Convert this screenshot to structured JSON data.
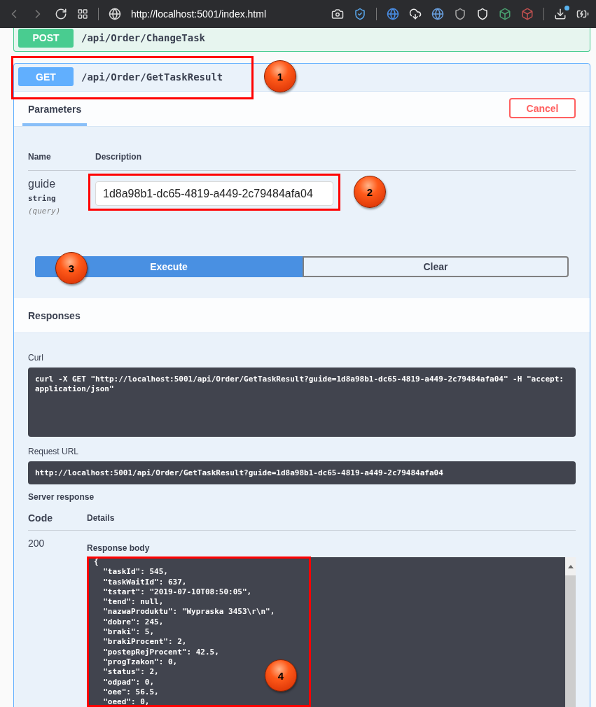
{
  "browser": {
    "url": "http://localhost:5001/index.html"
  },
  "endpoints": [
    {
      "method": "POST",
      "path": "/api/Order/ChangeTask",
      "color": "#49cc90",
      "expanded": false
    },
    {
      "method": "GET",
      "path": "/api/Order/GetTaskResult",
      "color": "#61affe",
      "expanded": true
    }
  ],
  "operation": {
    "tab": {
      "label": "Parameters",
      "selected": true
    },
    "cancel": "Cancel",
    "columns": [
      "Name",
      "Description"
    ],
    "parameters": [
      {
        "name": "guide",
        "type": "string",
        "location": "(query)",
        "value": "1d8a98b1-dc65-4819-a449-2c79484afa04"
      }
    ],
    "execute": "Execute",
    "clear": "Clear"
  },
  "responses": {
    "title": "Responses",
    "curl_label": "Curl",
    "curl": "curl -X GET \"http://localhost:5001/api/Order/GetTaskResult?guide=1d8a98b1-dc65-4819-a449-2c79484afa04\" -H \"accept: application/json\"",
    "request_url_label": "Request URL",
    "request_url": "http://localhost:5001/api/Order/GetTaskResult?guide=1d8a98b1-dc65-4819-a449-2c79484afa04",
    "server_response_label": "Server response",
    "columns": [
      "Code",
      "Details"
    ],
    "code": "200",
    "body_label": "Response body",
    "body_lines": [
      "{",
      "  \"taskId\": 545,",
      "  \"taskWaitId\": 637,",
      "  \"tstart\": \"2019-07-10T08:50:05\",",
      "  \"tend\": null,",
      "  \"nazwaProduktu\": \"Wypraska 3453\\r\\n\",",
      "  \"dobre\": 245,",
      "  \"braki\": 5,",
      "  \"brakiProcent\": 2,",
      "  \"postepRejProcent\": 42.5,",
      "  \"progTzakon\": 0,",
      "  \"status\": 2,",
      "  \"odpad\": 0,",
      "  \"oee\": 56.5,",
      "  \"oeed\": 0,"
    ]
  },
  "annotations": [
    {
      "label": "1"
    },
    {
      "label": "2"
    },
    {
      "label": "3"
    },
    {
      "label": "4"
    }
  ]
}
